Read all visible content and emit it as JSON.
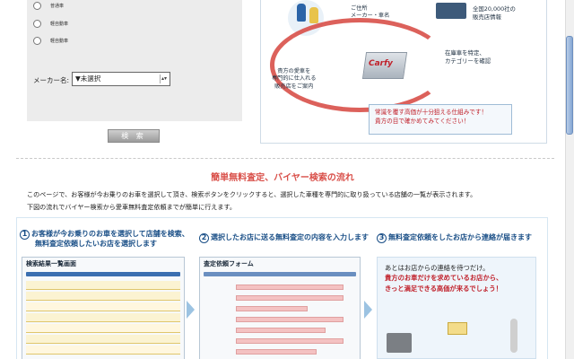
{
  "search_form": {
    "radio_options": [
      "普通車",
      "軽自動車",
      "軽自動車"
    ],
    "maker_label": "メーカー名:",
    "maker_selected": "▼未選択",
    "search_button": "検 索"
  },
  "illustration": {
    "seller_note": [
      "ご住所",
      "メーカー・車名"
    ],
    "store_count_line1": "全国20,000社の",
    "store_count_line2": "販売店情報",
    "cycle_note_line1": "在庫車を特定、",
    "cycle_note_line2": "カテゴリーを確認",
    "buyer_note_line1": "貴方の愛車を",
    "buyer_note_line2": "専門的に仕入れる",
    "buyer_note_line3": "販売店をご案内",
    "brand": "Carfy",
    "highlight_line1": "常識を覆す高価が十分狙える仕組みです！",
    "highlight_line2": "貴方の目で確かめてみてください！"
  },
  "section": {
    "title": "簡単無料査定、バイヤー検索の流れ",
    "desc_line1": "このページで、お客様が今お乗りのお車を選択して頂き、検索ボタンをクリックすると、選択した車種を専門的に取り扱っている店舗の一覧が表示されます。",
    "desc_line2": "下図の流れでバイヤー検索から愛車無料査定依頼までが簡単に行えます。"
  },
  "steps": [
    {
      "num": "1",
      "line1": "お客様が今お乗りのお車を選択して店舗を検索、",
      "line2": "無料査定依頼したいお店を選択します",
      "shot_title": "検索結果一覧画面"
    },
    {
      "num": "2",
      "line1": "選択したお店に送る無料査定の内容を入力します",
      "line2": "",
      "shot_title": "査定依頼フォーム"
    },
    {
      "num": "3",
      "line1": "無料査定依頼をしたお店から連絡が届きます",
      "line2": ""
    }
  ],
  "contact": {
    "line1": "あとはお店からの連絡を待つだけ。",
    "line2": "貴方のお車だけを求めているお店から、",
    "line3": "きっと満足できる高価が来るでしょう！"
  },
  "colors": {
    "accent_red": "#d9504a",
    "heading_blue": "#1a4f87",
    "panel_gray": "#ececec"
  },
  "icons": [
    "radio-icon",
    "dropdown-arrow-icon",
    "person-icon",
    "truck-icon",
    "carfy-box-icon",
    "envelope-icon",
    "phone-icon",
    "next-arrow-icon"
  ]
}
